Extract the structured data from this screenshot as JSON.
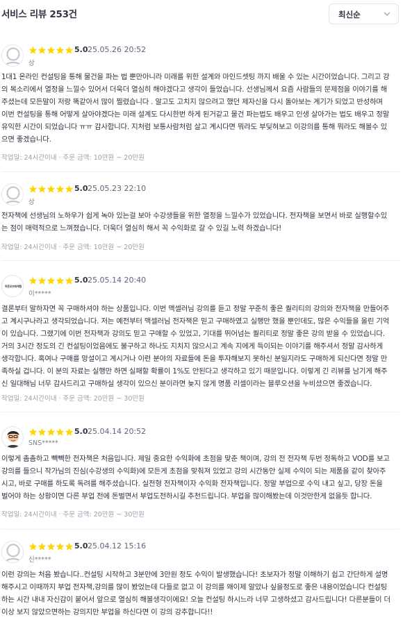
{
  "header": {
    "title": "서비스 리뷰 253건",
    "sort_selected": "최신순"
  },
  "colors": {
    "star": "#ffd400",
    "text": "#303441",
    "muted": "#9a9fab"
  },
  "reviews": [
    {
      "rating": "5.0",
      "date": "25.05.26 20:52",
      "user": "상",
      "avatar": "default-avatar",
      "lines": [
        "1대1 온라인 컨설팅을 통해 물건을 파는 법 뿐만아니라 미래를 위한 설계와 마인드셋팅 까지 배울 수 있는 시간이었습니다. 그리고 강",
        "의 목소리에서 열정을 느낄수 있어서 더욱더 열심히 해야겠다고 생각이 들었습니다. 선생님께서 요즘 사람들의 문제점을 이야기를 해",
        "주셨는데 모든말이 저랑 똑같아서 많이 찔렸습니다 . 알고도 고치지 않으려고 했던 제자신을 다시 돌아보는 계기가 되었고 반성하며",
        "이번 컨설팅을 통해 어떻게 살아야겠다는 미래 설계도 다시한번 하게 된거같고 물건 파는법도 배우고 인생 살아가는 법도 배우고 정말",
        "유익한 시간이 되었습니다 ㅠㅠ 감사합니다. 지처럼 보통사람처럼 살고 계시다면 뭐라도 부딪혀보고 이강의를 통해 뭐라도 해볼수 있",
        "으면 좋겠습니다."
      ],
      "meta_time": "작업일: 24시간이내",
      "meta_price": "주문 금액: 10만원 ~ 20만원"
    },
    {
      "rating": "5.0",
      "date": "25.05.23 22:10",
      "user": "상",
      "avatar": "default-avatar",
      "lines": [
        "전자책에 선생님의 노하우가 쉽게 녹아 있는걸 보아 수강생들을 위한 열정을 느낄수가 있었습니다. 전자책을 보면서 바로 실행할수있",
        "는 점이 매력적으로 느껴졌습니다. 더욱더 열심히 해서 꼭 수익화로 갈 수 있길 노력 하겠습니다!"
      ],
      "meta_time": "작업일: 24시간이내",
      "meta_price": "주문 금액: 10만원 ~ 20만원"
    },
    {
      "rating": "5.0",
      "date": "25.05.14 20:40",
      "user": "이*****",
      "avatar": "brand-logo",
      "avatar_text": "아웃오브마케팅",
      "lines": [
        "결론부터 말하자면 꼭 구매하셔야 하는 상품입니다. 이번 맥셀러님 강의를 듣고 정말 꾸준히 좋은 퀄리티의 강의와 전자책을 만들어주",
        "고 계시구나라고 생각되었습니다. 저는 예전부터 맥셀러님 전자책은 믿고 구매하였고 실행만 했을 뿐인데도, 많은 수익들을 올린 기억",
        "이 있습니다. 그랬기에 이번 전자책과 강의도 믿고 구매할 수 있었고, 기대를 뛰어넘는 퀄리티로 정말 좋은 강의 받을 수 있었습니다.",
        "거의 3시간 정도의 긴 컨설팅이었음에도 불구하고 하나도 지치지 않으시고 계속 지에게 득이되는 이야기를 해주셔서 정말 감사하게",
        "생각합니다. 혹여나 구매를 망설이고 계시거나 이런 분야의 자료들에 돈을 투자해보지 못하신 분일지라도 구매하게 되신다면 정말 만",
        "족하실 겁니다. 이 분의 자료는 실행만 하면 실패할 확률이 1%도 안된다고 생각하고 있기 때문입니다. 이렇게 긴 리뷰를 남기게 해주",
        "신 일대해님 너무 감사드리고 구매하실 생각이 있으신 분이라면 늦지 않게 명품 리셀이라는 블루오션을 누비셨으면 좋겠습니다."
      ],
      "meta_time": "작업일: 24시간이내",
      "meta_price": "주문 금액: 20만원 ~ 30만원"
    },
    {
      "rating": "5.0",
      "date": "25.04.14 20:52",
      "user": "SNS*****",
      "avatar": "character-avatar",
      "lines": [
        "이렇게 촘촘하고 빽빽한 전자책은 처음입니다. 제일 중요한 수익화에 초점을 맞춘 책이며, 강의 전 전자책 두번 정독하고 VOD를 보고",
        "강의를 들으니 작가님의 진심(수강생의 수익화)에 모든게 초점을 맞춰져 있었고 강의 시간동안 실제 수익이 되는 제품을 같이 찾아주",
        "시고, 바로 구매를 하도록 독려를 해주셨습니다. 실전형 전자책이자 수익화 전자책입니다. 정말 부업으로 수익 내고 싶고, 당장 돈을",
        "벌어야 하는 상황이면 다른 부업 전에 돈벌면서 부업도전하시길 추천드립니다. 부업을 많이해봤는데 이것만한게 없을듯 합니다."
      ],
      "meta_time": "작업일: 24시간이내",
      "meta_price": "주문 금액: 20만원 ~ 30만원"
    },
    {
      "rating": "5.0",
      "date": "25.04.12 15:16",
      "user": "신*****",
      "avatar": "default-avatar",
      "lines": [
        "이런 강의는 처음 봤습니다..컨설팅 시작하고 3분만에 3만원 정도 수익이 발생했습니다! 초보자가 정말 이해하기 쉽고 간단하게 설명",
        "해주시고 이때까지 부업 전자책,강의를 많이 봤었는데 다들로 없고 이 강의를 왜이제 알았나 싶을정도로 좋은 내용이었습니다 컨설팅",
        "하는 시간 내내 자신감이 붙어서 앞으로 열심히 해볼생각이에요! 오늘 컨설팅 하시느라 너무 고생하셨고 감사드립니다! 다른분들이 더",
        "이상 보지 않았으면하는 강의지만 부업을 하신다면 이 강의 강추합니다!!"
      ],
      "meta_time": "",
      "meta_price": ""
    }
  ]
}
